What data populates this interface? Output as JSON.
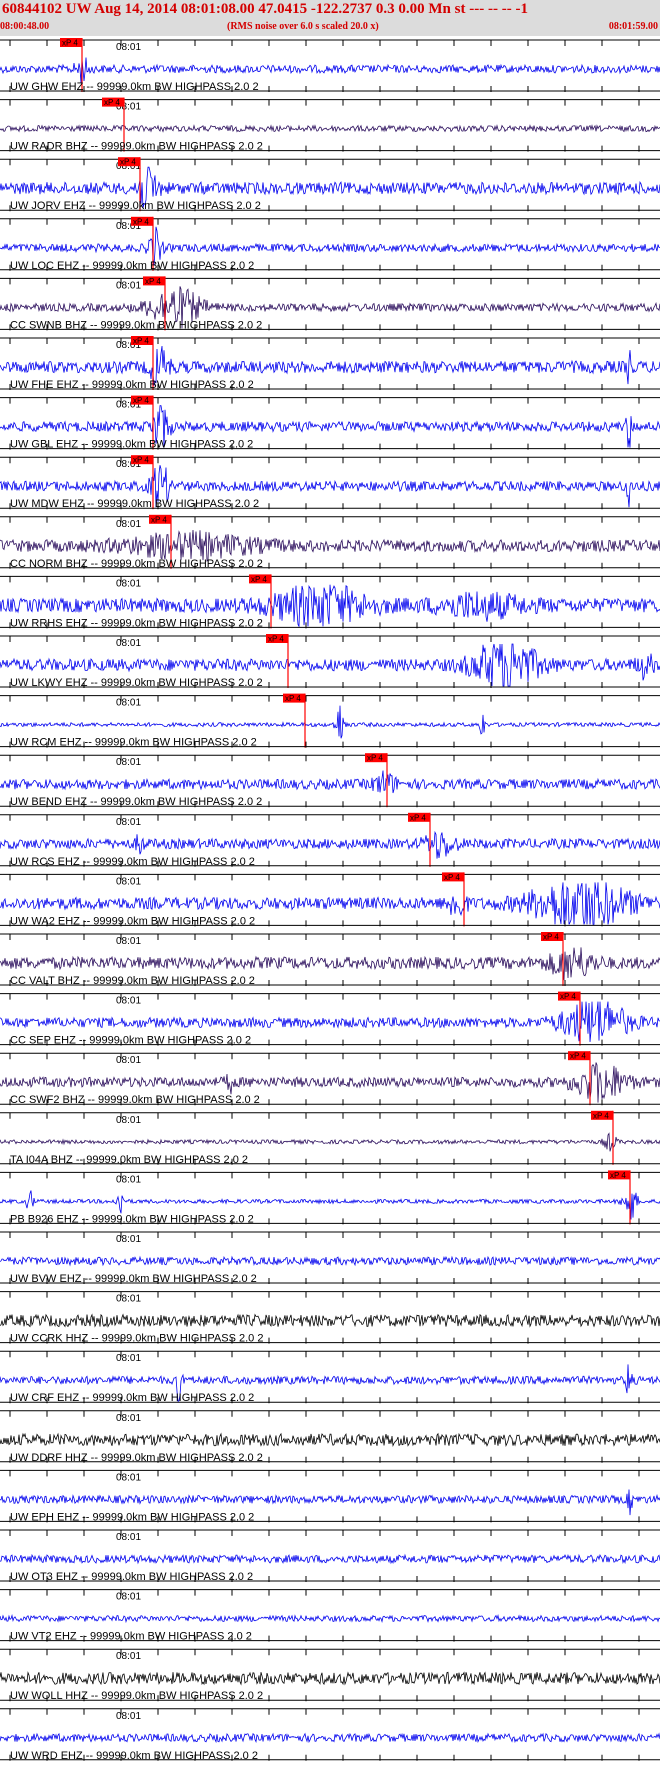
{
  "header": {
    "title": "60844102 UW Aug 14, 2014 08:01:08.00   47.0415 -122.2737  0.3 0.00 Mn st --- -- --   -1",
    "time_start": "08:00:48.00",
    "rms_note": "(RMS noise over 6.0 s scaled 20.0 x)",
    "time_end": "08:01:59.00"
  },
  "colors": {
    "blue": "#0000ee",
    "navy": "#2a0d5c",
    "black": "#000000",
    "red": "#ff0000",
    "header_text": "#d40000",
    "header_bg": "#dcdcdc"
  },
  "chart_data": {
    "type": "line",
    "x_range": [
      "08:00:48.00",
      "08:01:59.00"
    ],
    "time_tick_label": "08:01",
    "pick_label": "xP 4",
    "traces": [
      {
        "label": "UW GHW EHZ -- 99999.0km BW  HIGHPASS  2.0  2",
        "color": "blue",
        "amp": 4,
        "pick": 82,
        "events": [
          {
            "x": 82,
            "a": 12,
            "w": 6
          }
        ]
      },
      {
        "label": "UW RADR BHZ -- 99999.0km BW  HIGHPASS  2.0  2",
        "color": "navy",
        "amp": 3,
        "pick": 124,
        "events": []
      },
      {
        "label": "UW JORV EHZ -- 99999.0km BW  HIGHPASS  2.0  2",
        "color": "blue",
        "amp": 6,
        "pick": 140,
        "events": [
          {
            "x": 147,
            "a": 22,
            "w": 10
          }
        ]
      },
      {
        "label": "UW LOC EHZ -- 99999.0km BW  HIGHPASS  2.0  2",
        "color": "blue",
        "amp": 4,
        "pick": 153,
        "events": [
          {
            "x": 155,
            "a": 18,
            "w": 6
          }
        ]
      },
      {
        "label": "CC SWNB BHZ -- 99999.0km BW  HIGHPASS  2.0  2",
        "color": "navy",
        "amp": 4,
        "pick": 165,
        "events": [
          {
            "x": 175,
            "a": 20,
            "w": 24
          }
        ]
      },
      {
        "label": "UW FHE EHZ -- 99999.0km BW  HIGHPASS  2.0  2",
        "color": "blue",
        "amp": 6,
        "pick": 153,
        "events": [
          {
            "x": 160,
            "a": 24,
            "w": 8
          },
          {
            "x": 629,
            "a": 28,
            "w": 2
          }
        ]
      },
      {
        "label": "UW GBL EHZ -- 99999.0km BW  HIGHPASS  2.0  2",
        "color": "blue",
        "amp": 5,
        "pick": 153,
        "events": [
          {
            "x": 160,
            "a": 24,
            "w": 8
          },
          {
            "x": 629,
            "a": 28,
            "w": 2
          }
        ]
      },
      {
        "label": "UW MDW EHZ -- 99999.0km BW  HIGHPASS  2.0  2",
        "color": "blue",
        "amp": 5,
        "pick": 153,
        "events": [
          {
            "x": 160,
            "a": 24,
            "w": 8
          },
          {
            "x": 629,
            "a": 28,
            "w": 2
          }
        ]
      },
      {
        "label": "CC NORM BHZ -- 99999.0km BW  HIGHPASS  2.0  2",
        "color": "navy",
        "amp": 6,
        "pick": 171,
        "events": [
          {
            "x": 190,
            "a": 10,
            "w": 60
          }
        ]
      },
      {
        "label": "UW RRHS EHZ -- 99999.0km BW  HIGHPASS  2.0  2",
        "color": "blue",
        "amp": 7,
        "pick": 271,
        "events": [
          {
            "x": 320,
            "a": 18,
            "w": 45
          },
          {
            "x": 480,
            "a": 10,
            "w": 40
          }
        ]
      },
      {
        "label": "UW LKWY EHZ -- 99999.0km BW  HIGHPASS  2.0  2",
        "color": "blue",
        "amp": 6,
        "pick": 288,
        "events": [
          {
            "x": 505,
            "a": 26,
            "w": 30
          },
          {
            "x": 645,
            "a": 10,
            "w": 8
          }
        ]
      },
      {
        "label": "UW RCM EHZ -- 99999.0km BW  HIGHPASS  2.0  2",
        "color": "blue",
        "amp": 2,
        "pick": 305,
        "events": [
          {
            "x": 340,
            "a": 22,
            "w": 4
          },
          {
            "x": 482,
            "a": 18,
            "w": 2
          }
        ]
      },
      {
        "label": "UW BEND EHZ -- 99999.0km BW  HIGHPASS  2.0  2",
        "color": "blue",
        "amp": 5,
        "pick": 387,
        "events": [
          {
            "x": 385,
            "a": 10,
            "w": 10
          }
        ]
      },
      {
        "label": "UW RCS EHZ -- 99999.0km BW  HIGHPASS  2.0  2",
        "color": "blue",
        "amp": 5,
        "pick": 430,
        "events": [
          {
            "x": 140,
            "a": 12,
            "w": 3
          },
          {
            "x": 440,
            "a": 12,
            "w": 14
          }
        ]
      },
      {
        "label": "UW WA2 EHZ -- 99999.0km BW  HIGHPASS  2.0  2",
        "color": "blue",
        "amp": 6,
        "pick": 464,
        "events": [
          {
            "x": 457,
            "a": 14,
            "w": 8
          },
          {
            "x": 580,
            "a": 26,
            "w": 45
          }
        ]
      },
      {
        "label": "CC VALT BHZ -- 99999.0km BW  HIGHPASS  2.0  2",
        "color": "navy",
        "amp": 6,
        "pick": 563,
        "events": [
          {
            "x": 572,
            "a": 14,
            "w": 20
          }
        ]
      },
      {
        "label": "CC SEP EHZ -- 99999.0km BW  HIGHPASS  2.0  2",
        "color": "blue",
        "amp": 5,
        "pick": 580,
        "events": [
          {
            "x": 595,
            "a": 22,
            "w": 30
          }
        ]
      },
      {
        "label": "CC SWF2 BHZ -- 99999.0km BW  HIGHPASS  2.0  2",
        "color": "navy",
        "amp": 5,
        "pick": 590,
        "events": [
          {
            "x": 230,
            "a": 8,
            "w": 4
          },
          {
            "x": 600,
            "a": 18,
            "w": 24
          }
        ]
      },
      {
        "label": "TA I04A BHZ -- 99999.0km BW  HIGHPASS  2.0  2",
        "color": "navy",
        "amp": 2,
        "pick": 613,
        "events": [
          {
            "x": 610,
            "a": 8,
            "w": 6
          }
        ]
      },
      {
        "label": "PB B926 EHZ -- 99999.0km BW  HIGHPASS  2.0  2",
        "color": "blue",
        "amp": 2,
        "pick": 630,
        "events": [
          {
            "x": 30,
            "a": 12,
            "w": 3
          },
          {
            "x": 120,
            "a": 16,
            "w": 3
          },
          {
            "x": 630,
            "a": 20,
            "w": 6
          }
        ]
      },
      {
        "label": "UW BVW EHZ -- 99999.0km BW  HIGHPASS  2.0  2",
        "color": "blue",
        "amp": 4,
        "pick": null,
        "events": []
      },
      {
        "label": "UW CCRK HHZ -- 99999.0km BW  HIGHPASS  2.0  2",
        "color": "black",
        "amp": 6,
        "pick": null,
        "events": []
      },
      {
        "label": "UW CRF EHZ -- 99999.0km BW  HIGHPASS  2.0  2",
        "color": "blue",
        "amp": 4,
        "pick": null,
        "events": [
          {
            "x": 178,
            "a": 22,
            "w": 3
          },
          {
            "x": 629,
            "a": 26,
            "w": 2
          }
        ]
      },
      {
        "label": "UW DDRF HHZ -- 99999.0km BW  HIGHPASS  2.0  2",
        "color": "black",
        "amp": 6,
        "pick": null,
        "events": []
      },
      {
        "label": "UW EPH EHZ -- 99999.0km BW  HIGHPASS  2.0  2",
        "color": "blue",
        "amp": 4,
        "pick": null,
        "events": [
          {
            "x": 630,
            "a": 12,
            "w": 2
          }
        ]
      },
      {
        "label": "UW OT3 EHZ -- 99999.0km BW  HIGHPASS  2.0  2",
        "color": "blue",
        "amp": 4,
        "pick": null,
        "events": []
      },
      {
        "label": "UW VT2 EHZ -- 99999.0km BW  HIGHPASS  2.0  2",
        "color": "blue",
        "amp": 3,
        "pick": null,
        "events": []
      },
      {
        "label": "UW WOLL HHZ -- 99999.0km BW  HIGHPASS  2.0  2",
        "color": "black",
        "amp": 6,
        "pick": null,
        "events": []
      },
      {
        "label": "UW WRD EHZ -- 99999.0km BW  HIGHPASS  2.0  2",
        "color": "blue",
        "amp": 4,
        "pick": null,
        "events": []
      }
    ]
  }
}
